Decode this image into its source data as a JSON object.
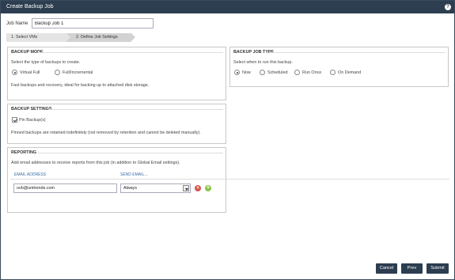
{
  "window": {
    "title": "Create Backup Job",
    "help_label": "?"
  },
  "job": {
    "name_label": "Job Name",
    "name_value": "Backup Job 1"
  },
  "wizard": {
    "steps": [
      {
        "label": "1. Select VMs"
      },
      {
        "label": "2. Define Job Settings"
      }
    ]
  },
  "backup_mode": {
    "title": "BACKUP MODE",
    "instruction": "Select the type of backups to create.",
    "options": [
      {
        "label": "Virtual Full",
        "selected": true
      },
      {
        "label": "Full/Incremental",
        "selected": false
      }
    ],
    "description": "Fast backups and recovery, ideal for backing up to attached disk storage."
  },
  "backup_job_type": {
    "title": "BACKUP JOB TYPE",
    "instruction": "Select when to run this backup.",
    "options": [
      {
        "label": "Now",
        "selected": true
      },
      {
        "label": "Scheduled",
        "selected": false
      },
      {
        "label": "Run Once",
        "selected": false
      },
      {
        "label": "On Demand",
        "selected": false
      }
    ]
  },
  "backup_settings": {
    "title": "BACKUP SETTINGS",
    "pin_label": "Pin Backup(s)",
    "pin_checked": true,
    "note": "Pinned backups are retained indefinitely (not removed by retention and cannot be deleted manually)."
  },
  "reporting": {
    "title": "REPORTING",
    "instruction": "Add email addresses to receive reports from this job (in addition to Global Email settings).",
    "col_email": "EMAIL ADDRESS",
    "col_send": "SEND EMAIL...",
    "rows": [
      {
        "email": "uvb@unitrends.com",
        "send": "Always"
      }
    ]
  },
  "buttons": {
    "cancel": "Cancel",
    "prev": "Prev",
    "submit": "Submit"
  },
  "colors": {
    "titlebar": "#2c3e50",
    "button": "#2c3e50",
    "remove": "#d9534f",
    "add": "#8bc34a",
    "link": "#3a6ea5"
  }
}
